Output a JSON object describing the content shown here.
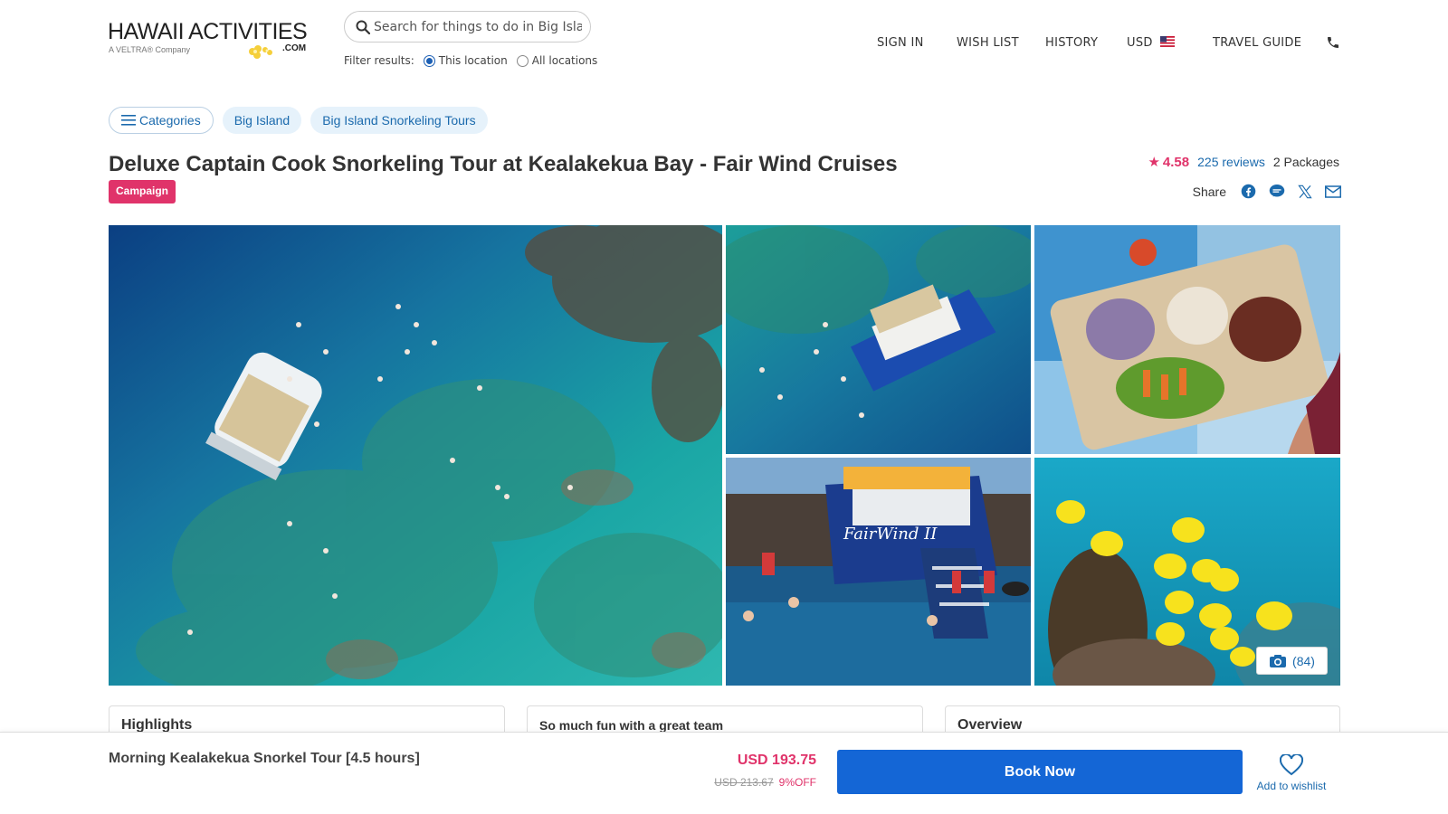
{
  "header": {
    "logo": {
      "main": "HAWAII ACTIVITIES",
      "sub": "A VELTRA® Company",
      "com": ".COM"
    },
    "search": {
      "placeholder": "Search for things to do in Big Island"
    },
    "filter": {
      "label": "Filter results:",
      "option_this": "This location",
      "option_all": "All locations",
      "selected": "This location"
    },
    "nav": {
      "sign_in": "SIGN IN",
      "wish_list": "WISH LIST",
      "history": "HISTORY",
      "currency": "USD",
      "travel_guide": "TRAVEL GUIDE"
    }
  },
  "breadcrumb": {
    "categories": "Categories",
    "items": [
      "Big Island",
      "Big Island Snorkeling Tours"
    ]
  },
  "tour": {
    "title": "Deluxe Captain Cook Snorkeling Tour at Kealakekua Bay - Fair Wind Cruises",
    "badge": "Campaign",
    "rating": "4.58",
    "reviews": "225 reviews",
    "packages": "2 Packages",
    "share_label": "Share"
  },
  "gallery": {
    "photo_count": "(84)"
  },
  "cards": {
    "highlights": "Highlights",
    "review_title": "So much fun with a great team",
    "overview": "Overview"
  },
  "booking": {
    "package_name": "Morning Kealakekua Snorkel Tour [4.5 hours]",
    "price": "USD 193.75",
    "old_price": "USD 213.67",
    "discount": "9%OFF",
    "book_label": "Book Now",
    "wishlist_label": "Add to wishlist"
  },
  "colors": {
    "accent_pink": "#e0336a",
    "link_blue": "#1b6aad",
    "button_blue": "#1466d6"
  }
}
